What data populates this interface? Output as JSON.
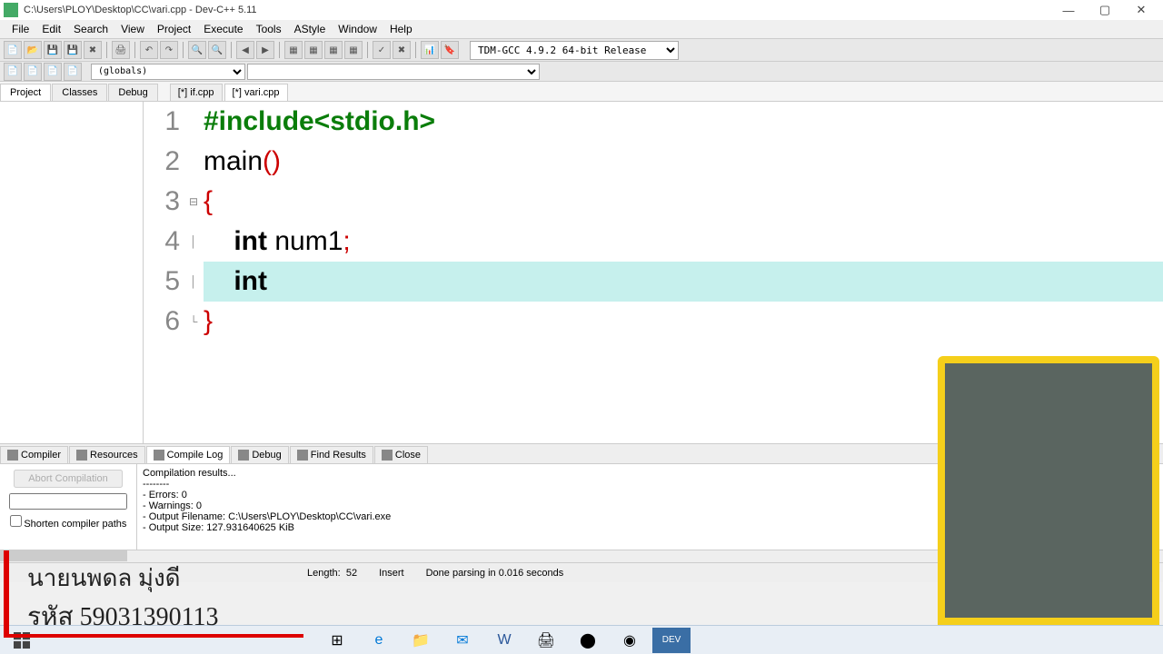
{
  "window": {
    "title": "C:\\Users\\PLOY\\Desktop\\CC\\vari.cpp - Dev-C++ 5.11"
  },
  "menu": [
    "File",
    "Edit",
    "Search",
    "View",
    "Project",
    "Execute",
    "Tools",
    "AStyle",
    "Window",
    "Help"
  ],
  "compiler_select": "TDM-GCC 4.9.2 64-bit Release",
  "globals": "(globals)",
  "side_tabs": [
    "Project",
    "Classes",
    "Debug"
  ],
  "file_tabs": [
    {
      "label": "[*] if.cpp",
      "active": false
    },
    {
      "label": "[*] vari.cpp",
      "active": true
    }
  ],
  "code": {
    "lines": [
      "1",
      "2",
      "3",
      "4",
      "5",
      "6"
    ],
    "l1_a": "#include",
    "l1_b": "<stdio.h>",
    "l2_a": "main",
    "l2_b": "()",
    "l3": "{",
    "l4_a": "int",
    "l4_b": " num1",
    "l4_c": ";",
    "l5_a": "int",
    "l6": "}"
  },
  "bottom_tabs": [
    "Compiler",
    "Resources",
    "Compile Log",
    "Debug",
    "Find Results",
    "Close"
  ],
  "abort_btn": "Abort Compilation",
  "shorten_label": "Shorten compiler paths",
  "compile_output": "Compilation results...\n--------\n- Errors: 0\n- Warnings: 0\n- Output Filename: C:\\Users\\PLOY\\Desktop\\CC\\vari.exe\n- Output Size: 127.931640625 KiB",
  "status": {
    "length_label": "Length:",
    "length_val": "52",
    "insert": "Insert",
    "parse": "Done parsing in 0.016 seconds"
  },
  "overlay": {
    "line1": "นายนพดล มุ่งดี",
    "line2": "รหัส 59031390113"
  }
}
